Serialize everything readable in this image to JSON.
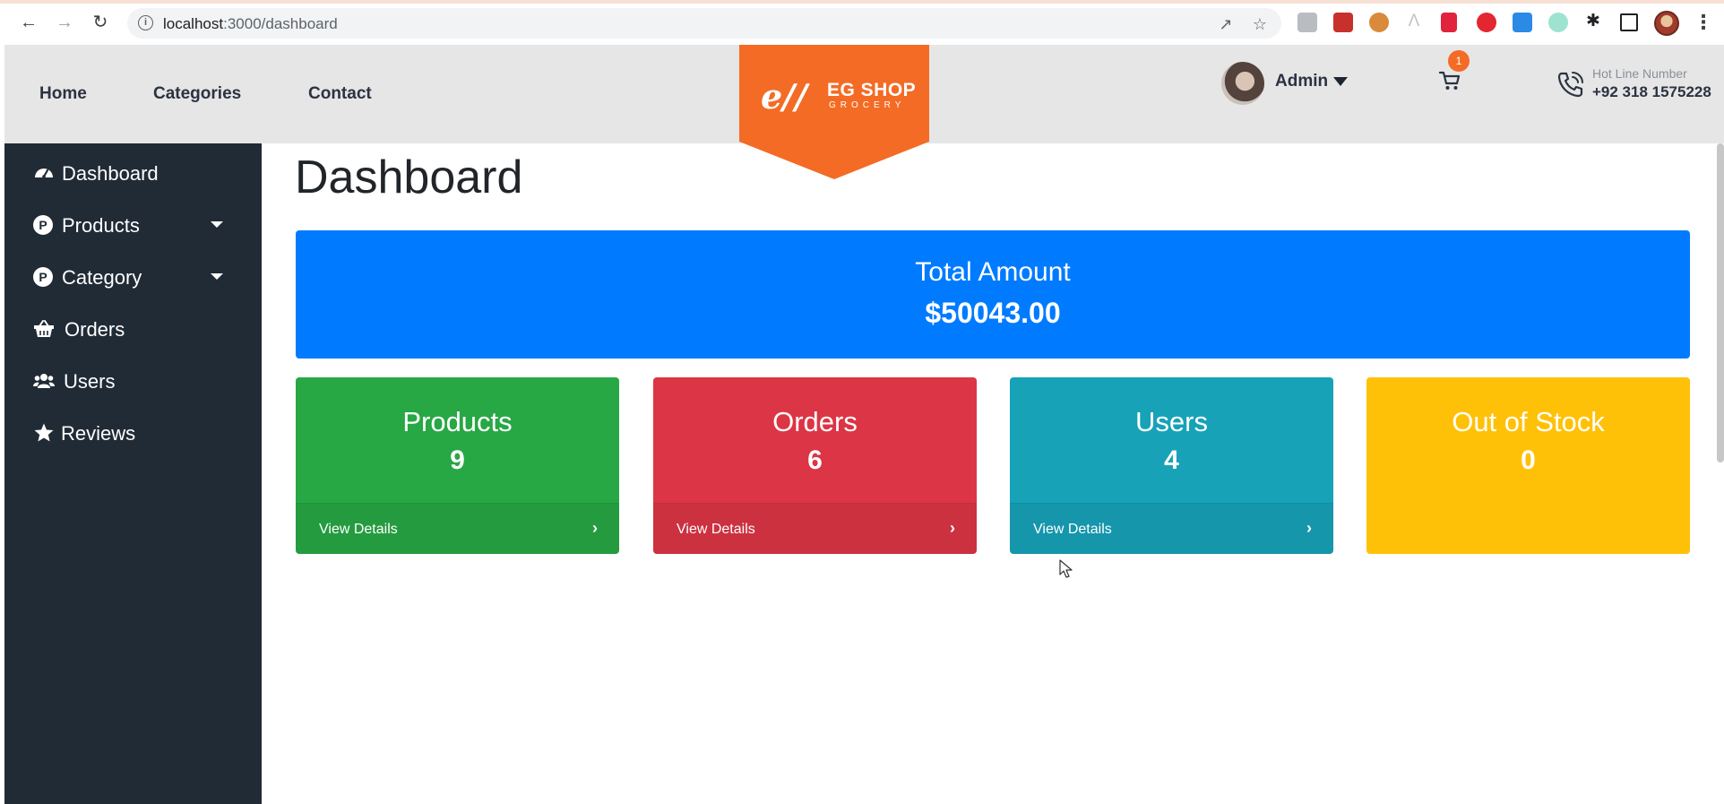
{
  "browser": {
    "url_host": "localhost",
    "url_path": ":3000/dashboard"
  },
  "header": {
    "nav": [
      {
        "label": "Home"
      },
      {
        "label": "Categories"
      },
      {
        "label": "Contact"
      }
    ],
    "logo": {
      "title": "EG SHOP",
      "subtitle": "GROCERY",
      "mark": "e∕∕"
    },
    "admin_label": "Admin",
    "cart_count": "1",
    "hotline_label": "Hot Line Number",
    "hotline_number": "+92 318 1575228"
  },
  "sidebar": {
    "items": [
      {
        "label": "Dashboard",
        "icon": "tachometer-icon"
      },
      {
        "label": "Products",
        "icon": "product-p-icon",
        "p": "P"
      },
      {
        "label": "Category",
        "icon": "category-p-icon",
        "p": "P"
      },
      {
        "label": "Orders",
        "icon": "basket-icon"
      },
      {
        "label": "Users",
        "icon": "users-icon"
      },
      {
        "label": "Reviews",
        "icon": "star-icon"
      }
    ]
  },
  "main": {
    "title": "Dashboard",
    "total": {
      "label": "Total Amount",
      "value": "$50043.00",
      "color": "#007bff"
    },
    "cards": [
      {
        "label": "Products",
        "value": "9",
        "link": "View Details",
        "color": "#28a745"
      },
      {
        "label": "Orders",
        "value": "6",
        "link": "View Details",
        "color": "#dc3545"
      },
      {
        "label": "Users",
        "value": "4",
        "link": "View Details",
        "color": "#17a2b8"
      },
      {
        "label": "Out of Stock",
        "value": "0",
        "color": "#ffc107"
      }
    ]
  },
  "colors": {
    "brand_orange": "#f46b25",
    "sidebar_bg": "#212b36"
  }
}
